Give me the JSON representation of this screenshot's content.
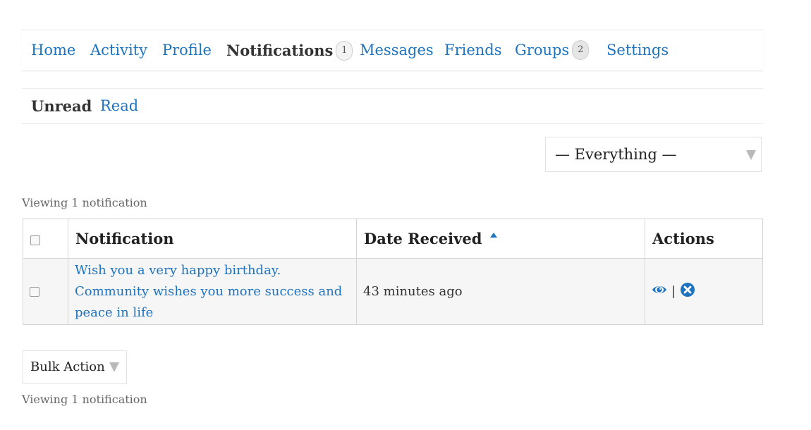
{
  "nav": {
    "items": [
      {
        "label": "Home"
      },
      {
        "label": "Activity"
      },
      {
        "label": "Profile"
      },
      {
        "label": "Notifications",
        "count": "1"
      },
      {
        "label": "Messages"
      },
      {
        "label": "Friends"
      },
      {
        "label": "Groups",
        "count": "2"
      },
      {
        "label": "Settings"
      }
    ]
  },
  "subnav": {
    "items": [
      {
        "label": "Unread"
      },
      {
        "label": "Read"
      }
    ]
  },
  "filter": {
    "selected": "— Everything —"
  },
  "viewing_text": "Viewing 1 notification",
  "table": {
    "headers": {
      "notification": "Notification",
      "date": "Date Received",
      "actions": "Actions"
    },
    "rows": [
      {
        "notification": "Wish you a very happy birthday. Community wishes you more success and peace in life",
        "date": "43 minutes ago"
      }
    ],
    "action_separator": "|"
  },
  "bulk": {
    "selected": "Bulk Actions"
  },
  "colors": {
    "link": "#1e73be",
    "text": "#333333",
    "border": "#d4d4d4"
  }
}
